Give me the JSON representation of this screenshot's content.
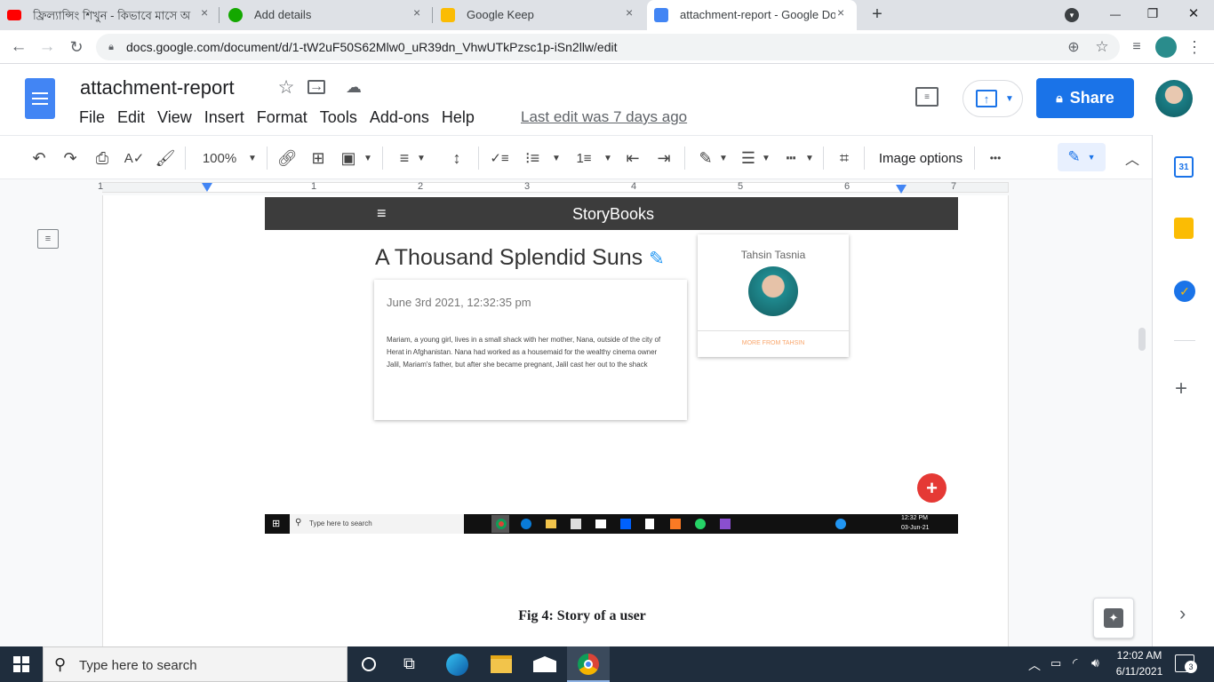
{
  "browser": {
    "tabs": [
      {
        "label": "ফ্রিল্যান্সিং শিখুন - কিভাবে মাসে অ",
        "close": "×"
      },
      {
        "label": "Add details",
        "close": "×"
      },
      {
        "label": "Google Keep",
        "close": "×"
      },
      {
        "label": "attachment-report - Google Doc",
        "close": "×"
      }
    ],
    "new_tab": "+",
    "url": "docs.google.com/document/d/1-tW2uF50S62Mlw0_uR39dn_VhwUTkPzsc1p-iSn2llw/edit",
    "window": {
      "minimize": "—",
      "maximize": "❐",
      "close": "✕"
    }
  },
  "docs": {
    "title": "attachment-report",
    "menu": [
      "File",
      "Edit",
      "View",
      "Insert",
      "Format",
      "Tools",
      "Add-ons",
      "Help"
    ],
    "last_edit": "Last edit was 7 days ago",
    "share_label": "Share",
    "toolbar": {
      "zoom": "100%",
      "image_options": "Image options",
      "more": "•••"
    },
    "ruler": [
      "1",
      "1",
      "2",
      "3",
      "4",
      "5",
      "6",
      "7"
    ]
  },
  "screenshot": {
    "brand": "StoryBooks",
    "story_title": "A Thousand Splendid Suns",
    "date": "June 3rd 2021, 12:32:35 pm",
    "body": "Mariam, a young girl, lives in a small shack with her mother, Nana, outside of the city of Herat in Afghanistan. Nana had worked as a housemaid for the wealthy cinema owner Jalil, Mariam's father, but after she became pregnant, Jalil cast her out to the shack",
    "author": "Tahsin Tasnia",
    "more_link": "MORE FROM TAHSIN",
    "fab": "+",
    "taskbar_search": "Type here to search",
    "clock_time": "12:32 PM",
    "clock_date": "03-Jun-21"
  },
  "caption": "Fig 4: Story of a user",
  "side": {
    "calendar_day": "31",
    "add": "+",
    "expand": "›"
  },
  "taskbar": {
    "search_placeholder": "Type here to search",
    "time": "12:02 AM",
    "date": "6/11/2021",
    "notifications": "3"
  },
  "colors": {
    "accent": "#1a73e8",
    "fab": "#e53935",
    "docs_blue": "#4285f4"
  }
}
